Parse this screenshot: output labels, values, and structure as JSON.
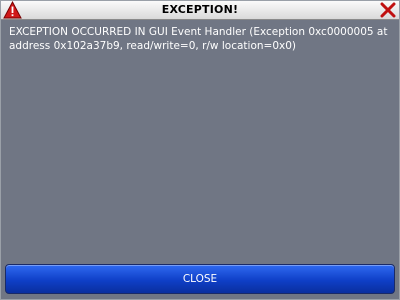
{
  "window": {
    "title": "EXCEPTION!",
    "icon": "warning-icon",
    "close_icon": "close-icon"
  },
  "message": {
    "text": "EXCEPTION OCCURRED IN GUI Event Handler (Exception 0xc0000005 at address 0x102a37b9, read/write=0, r/w location=0x0)"
  },
  "actions": {
    "close_label": "CLOSE"
  },
  "colors": {
    "body_bg": "#707684",
    "button_blue": "#0f3fc7",
    "warning_red": "#d01818"
  }
}
